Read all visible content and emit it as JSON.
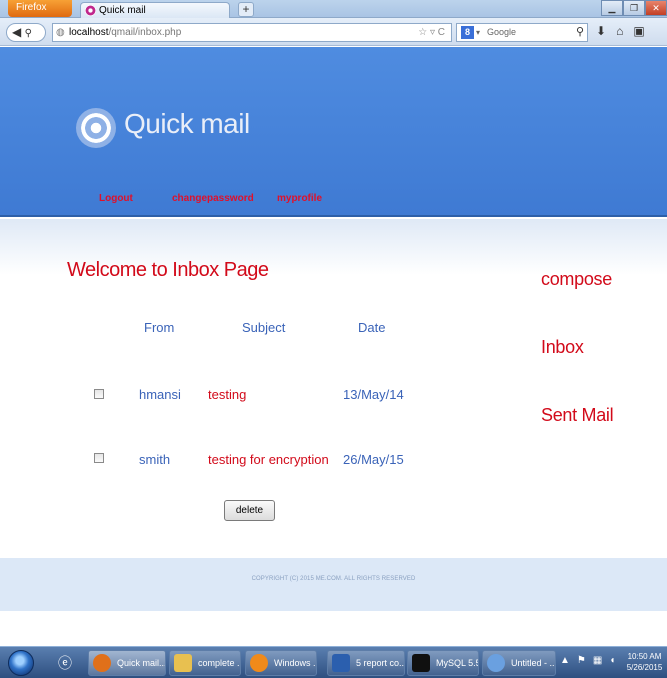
{
  "browser": {
    "firefox_button": "Firefox",
    "tab_title": "Quick mail",
    "new_tab": "+",
    "url_host": "localhost",
    "url_path": "/qmail/inbox.php",
    "search_placeholder": "Google"
  },
  "site": {
    "logo": "Quick mail",
    "nav": {
      "logout": "Logout",
      "changepassword": "changepassword",
      "myprofile": "myprofile"
    },
    "welcome": "Welcome to Inbox Page",
    "side": {
      "compose": "compose",
      "inbox": "Inbox",
      "sent": "Sent Mail"
    },
    "table": {
      "headers": {
        "from": "From",
        "subject": "Subject",
        "date": "Date"
      },
      "rows": [
        {
          "from": "hmansi",
          "subject": "testing",
          "date": "13/May/14"
        },
        {
          "from": "smith",
          "subject": "testing for encryption",
          "date": "26/May/15"
        }
      ]
    },
    "delete_label": "delete",
    "copyright": "COPYRIGHT (C) 2015 ME.COM. ALL RIGHTS RESERVED"
  },
  "taskbar": {
    "items": [
      {
        "label": "Quick mail...",
        "color": "#e0701a"
      },
      {
        "label": "complete ...",
        "color": "#e8c050"
      },
      {
        "label": "Windows ...",
        "color": "#f08a1a"
      },
      {
        "label": "5 report co...",
        "color": "#2b5fae"
      },
      {
        "label": "MySQL 5.5...",
        "color": "#101010"
      },
      {
        "label": "Untitled - ...",
        "color": "#6aa0e0"
      }
    ],
    "clock_time": "10:50 AM",
    "clock_date": "5/26/2015"
  }
}
